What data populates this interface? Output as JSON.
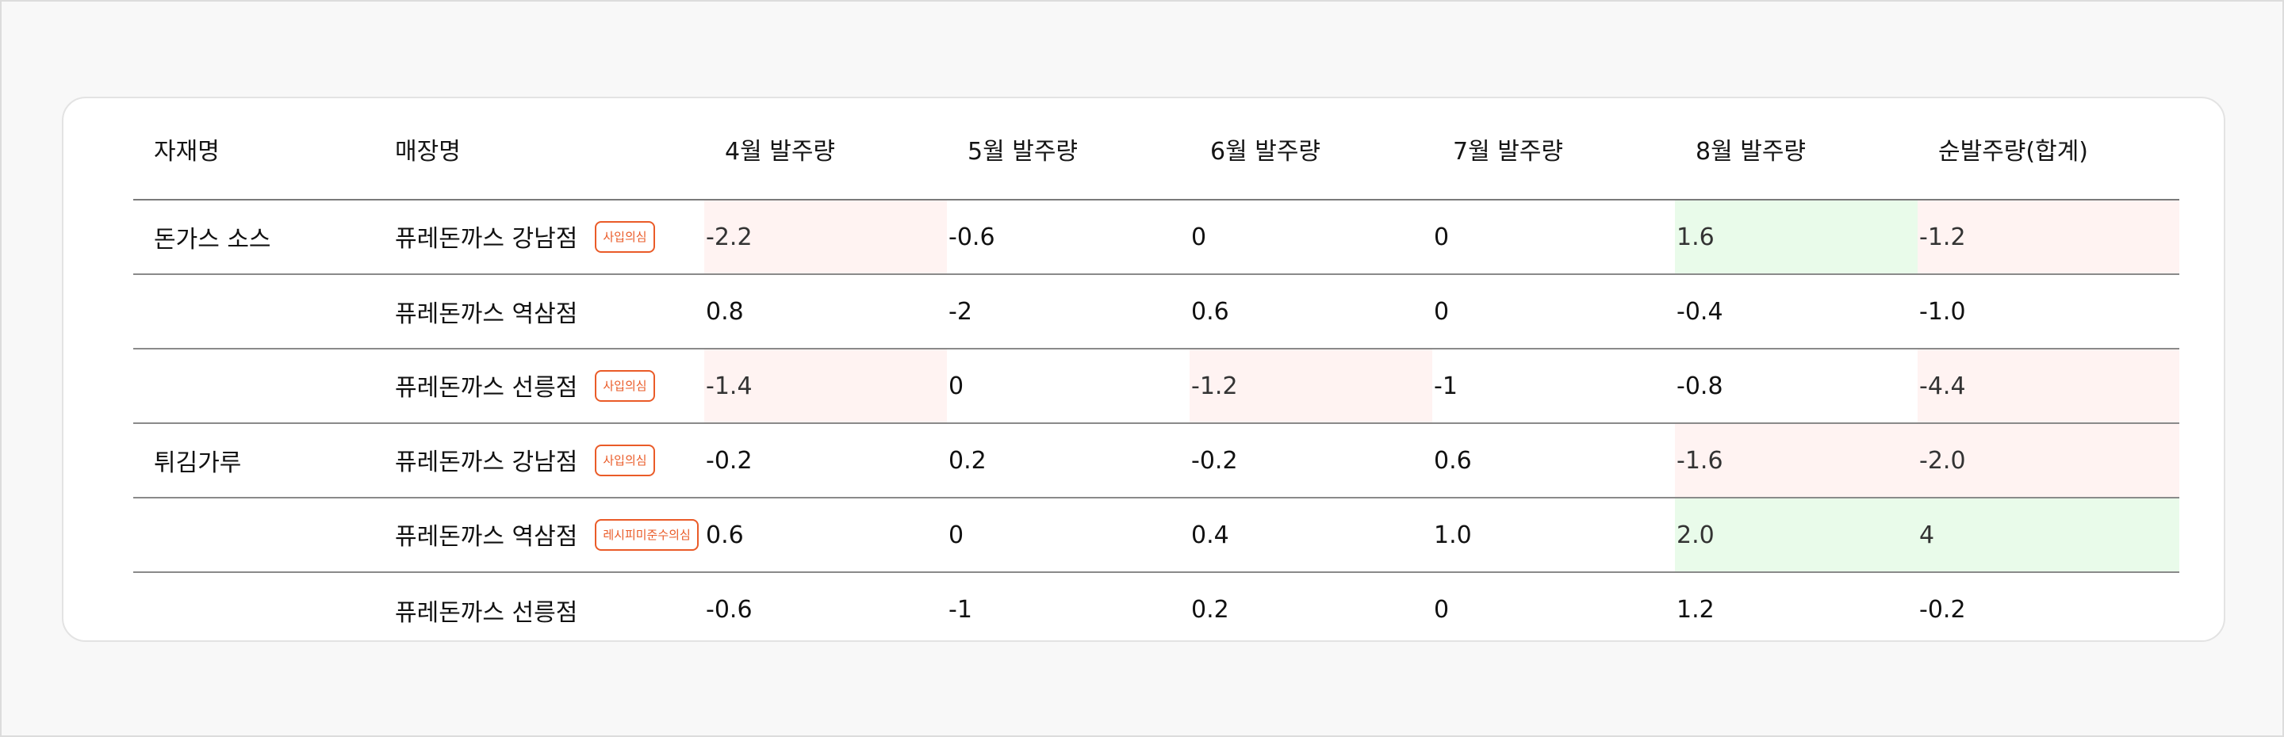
{
  "table": {
    "headers": [
      "자재명",
      "매장명",
      "4월 발주량",
      "5월 발주량",
      "6월 발주량",
      "7월 발주량",
      "8월 발주량",
      "순발주량(합계)"
    ],
    "rows": [
      {
        "material": "돈가스 소스",
        "store": "퓨레돈까스 강남점",
        "badge": "사입의심",
        "values": [
          "-2.2",
          "-0.6",
          "0",
          "0",
          "1.6",
          "-1.2"
        ],
        "highlight": [
          "neg",
          "",
          "",
          "",
          "pos",
          "neg"
        ]
      },
      {
        "material": "",
        "store": "퓨레돈까스 역삼점",
        "badge": "",
        "values": [
          "0.8",
          "-2",
          "0.6",
          "0",
          "-0.4",
          "-1.0"
        ],
        "highlight": [
          "",
          "",
          "",
          "",
          "",
          ""
        ]
      },
      {
        "material": "",
        "store": "퓨레돈까스 선릉점",
        "badge": "사입의심",
        "values": [
          "-1.4",
          "0",
          "-1.2",
          "-1",
          "-0.8",
          "-4.4"
        ],
        "highlight": [
          "neg",
          "",
          "neg",
          "",
          "",
          "neg"
        ]
      },
      {
        "material": "튀김가루",
        "store": "퓨레돈까스 강남점",
        "badge": "사입의심",
        "values": [
          "-0.2",
          "0.2",
          "-0.2",
          "0.6",
          "-1.6",
          "-2.0"
        ],
        "highlight": [
          "",
          "",
          "",
          "",
          "neg",
          "neg"
        ]
      },
      {
        "material": "",
        "store": "퓨레돈까스 역삼점",
        "badge": "레시피미준수의심",
        "values": [
          "0.6",
          "0",
          "0.4",
          "1.0",
          "2.0",
          "4"
        ],
        "highlight": [
          "",
          "",
          "",
          "",
          "pos",
          "pos"
        ]
      },
      {
        "material": "",
        "store": "퓨레돈까스 선릉점",
        "badge": "",
        "values": [
          "-0.6",
          "-1",
          "0.2",
          "0",
          "1.2",
          "-0.2"
        ],
        "highlight": [
          "",
          "",
          "",
          "",
          "",
          ""
        ]
      }
    ]
  },
  "colors": {
    "badge": "#ea5b28",
    "negative_bg": "#fff3f2",
    "positive_bg": "#e9fbea"
  }
}
